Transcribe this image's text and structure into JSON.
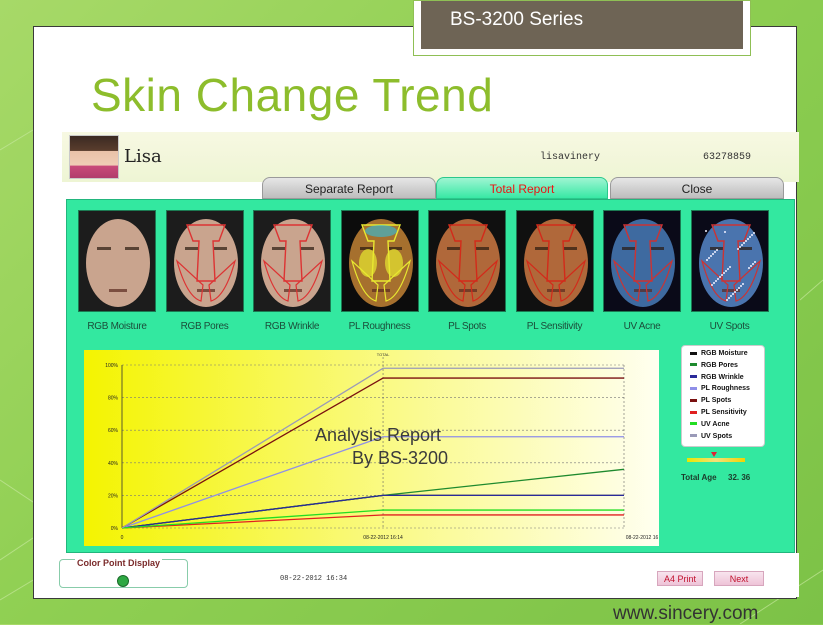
{
  "slide": {
    "series_label": "BS-3200 Series",
    "title": "Skin Change Trend",
    "website": "www.sincery.com"
  },
  "app": {
    "user": {
      "name": "Lisa",
      "login": "lisavinery",
      "id": "63278859"
    },
    "tabs": [
      {
        "label": "Separate Report",
        "active": false
      },
      {
        "label": "Total Report",
        "active": true
      },
      {
        "label": "Close",
        "active": false
      }
    ],
    "thumbnails": [
      {
        "label": "RGB Moisture",
        "tone": "natural"
      },
      {
        "label": "RGB Pores",
        "tone": "natural"
      },
      {
        "label": "RGB Wrinkle",
        "tone": "natural"
      },
      {
        "label": "PL Roughness",
        "tone": "heatmap"
      },
      {
        "label": "PL Spots",
        "tone": "orange"
      },
      {
        "label": "PL Sensitivity",
        "tone": "orange"
      },
      {
        "label": "UV Acne",
        "tone": "blue"
      },
      {
        "label": "UV Spots",
        "tone": "blue-spots"
      }
    ],
    "overlay_text": {
      "line1": "Analysis Report",
      "line2": "By BS-3200"
    },
    "age": {
      "label": "Total Age",
      "value": "32. 36"
    },
    "footer": {
      "color_point_label": "Color Point Display",
      "date": "08-22-2012 16:34",
      "print_label": "A4 Print",
      "next_label": "Next"
    }
  },
  "chart_data": {
    "type": "line",
    "x": [
      "0",
      "08-22-2012 16:14",
      "08-22-2012 16"
    ],
    "y_ticks": [
      "0%",
      "20%",
      "40%",
      "60%",
      "80%",
      "100%"
    ],
    "ylim": [
      0,
      100
    ],
    "top_label": "TOTAL",
    "series": [
      {
        "name": "RGB Moisture",
        "color": "#111111",
        "values": [
          0,
          20,
          20
        ]
      },
      {
        "name": "RGB Pores",
        "color": "#1e8a2e",
        "values": [
          0,
          20,
          36
        ]
      },
      {
        "name": "RGB Wrinkle",
        "color": "#2a2a9a",
        "values": [
          0,
          20,
          20
        ]
      },
      {
        "name": "PL Roughness",
        "color": "#8f8fe8",
        "values": [
          0,
          56,
          56
        ]
      },
      {
        "name": "PL Spots",
        "color": "#7a1010",
        "values": [
          0,
          92,
          92
        ]
      },
      {
        "name": "PL Sensitivity",
        "color": "#e02020",
        "values": [
          0,
          8,
          8
        ]
      },
      {
        "name": "UV Acne",
        "color": "#22dd22",
        "values": [
          0,
          11,
          11
        ]
      },
      {
        "name": "UV Spots",
        "color": "#9a9ab8",
        "values": [
          0,
          98,
          98
        ]
      }
    ],
    "legend_position": "right",
    "grid": true
  }
}
